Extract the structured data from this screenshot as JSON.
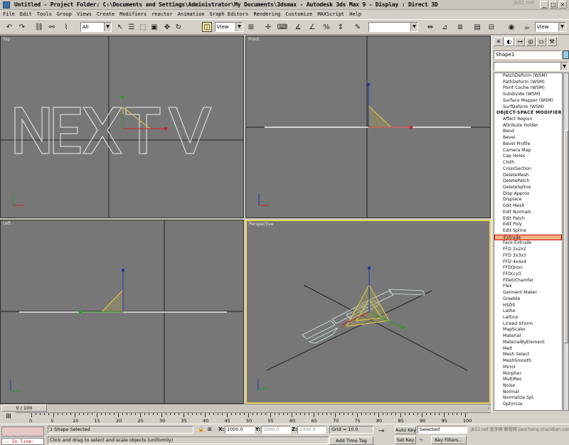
{
  "title": "Untitled    - Project Folder: C:\\Documents and Settings\\Administrator\\My Documents\\3dsmax     - Autodesk 3ds Max 9          - Display : Direct 3D",
  "watermark_top": "jb51.net",
  "menu": [
    "File",
    "Edit",
    "Tools",
    "Group",
    "Views",
    "Create",
    "Modifiers",
    "reactor",
    "Animation",
    "Graph Editors",
    "Rendering",
    "Customize",
    "MAXScript",
    "Help"
  ],
  "toolbar": {
    "filter": "All",
    "coord": "View",
    "coord_right": "View",
    "named_sel": ""
  },
  "viewports": {
    "top": "Top",
    "front": "Front",
    "left": "Left",
    "perspective": "Perspective",
    "logo_text": "NEXTV"
  },
  "panel": {
    "object_name": "Shape1",
    "modifier_list": "",
    "items": [
      "PatchDeform (WSM)",
      "PathDeform (WSM)",
      "Point Cache (WSM)",
      "Subdivide (WSM)",
      "Surface Mapper (WSM)",
      "SurfDeform (WSM)",
      "OBJECT-SPACE MODIFIERS",
      "Affect Region",
      "Attribute Holder",
      "Bend",
      "Bevel",
      "Bevel Profile",
      "Camera Map",
      "Cap Holes",
      "Cloth",
      "CrossSection",
      "DeleteMesh",
      "DeletePatch",
      "DeleteSpline",
      "Disp Approx",
      "Displace",
      "Edit Mesh",
      "Edit Normals",
      "Edit Patch",
      "Edit Poly",
      "Edit Spline",
      "Extrude",
      "Face Extrude",
      "FFD 2x2x2",
      "FFD 3x3x3",
      "FFD 4x4x4",
      "FFD(box)",
      "FFD(cyl)",
      "Fillet/Chamfer",
      "Flex",
      "Garment Maker",
      "Greeble",
      "HSDS",
      "Lathe",
      "Lattice",
      "Linked XForm",
      "MapScaler",
      "Material",
      "MaterialByElement",
      "Melt",
      "Mesh Select",
      "MeshSmooth",
      "Mirror",
      "Morpher",
      "MultiRes",
      "Noise",
      "Normal",
      "Normalize Spl.",
      "Optimize"
    ],
    "highlighted": "Extrude"
  },
  "timeline": {
    "frame": "0 / 100",
    "ticks": [
      "0",
      "5",
      "10",
      "15",
      "20",
      "25",
      "30",
      "35",
      "40",
      "45",
      "50",
      "55",
      "60",
      "65",
      "70",
      "75",
      "80",
      "85",
      "90",
      "95",
      "100"
    ]
  },
  "status": {
    "selection": "1 Shape Selected",
    "prompt": "Click and drag to select and scale objects (uniformly)",
    "x_label": "X:",
    "x_value": "1000.0",
    "y_label": "Y:",
    "y_value": "1000.0",
    "z_label": "Z:",
    "z_value": "1000.0",
    "grid": "Grid = 10.0",
    "add_time_tag": "Add Time Tag",
    "auto_key": "Auto Key",
    "set_key": "Set Key",
    "selected": "Selected",
    "key_filters": "Key Filters...",
    "in_line": "-- In line:"
  },
  "watermark_bottom": "jb51.net  查字典 教程网  jiaocheng.chazidian.com"
}
